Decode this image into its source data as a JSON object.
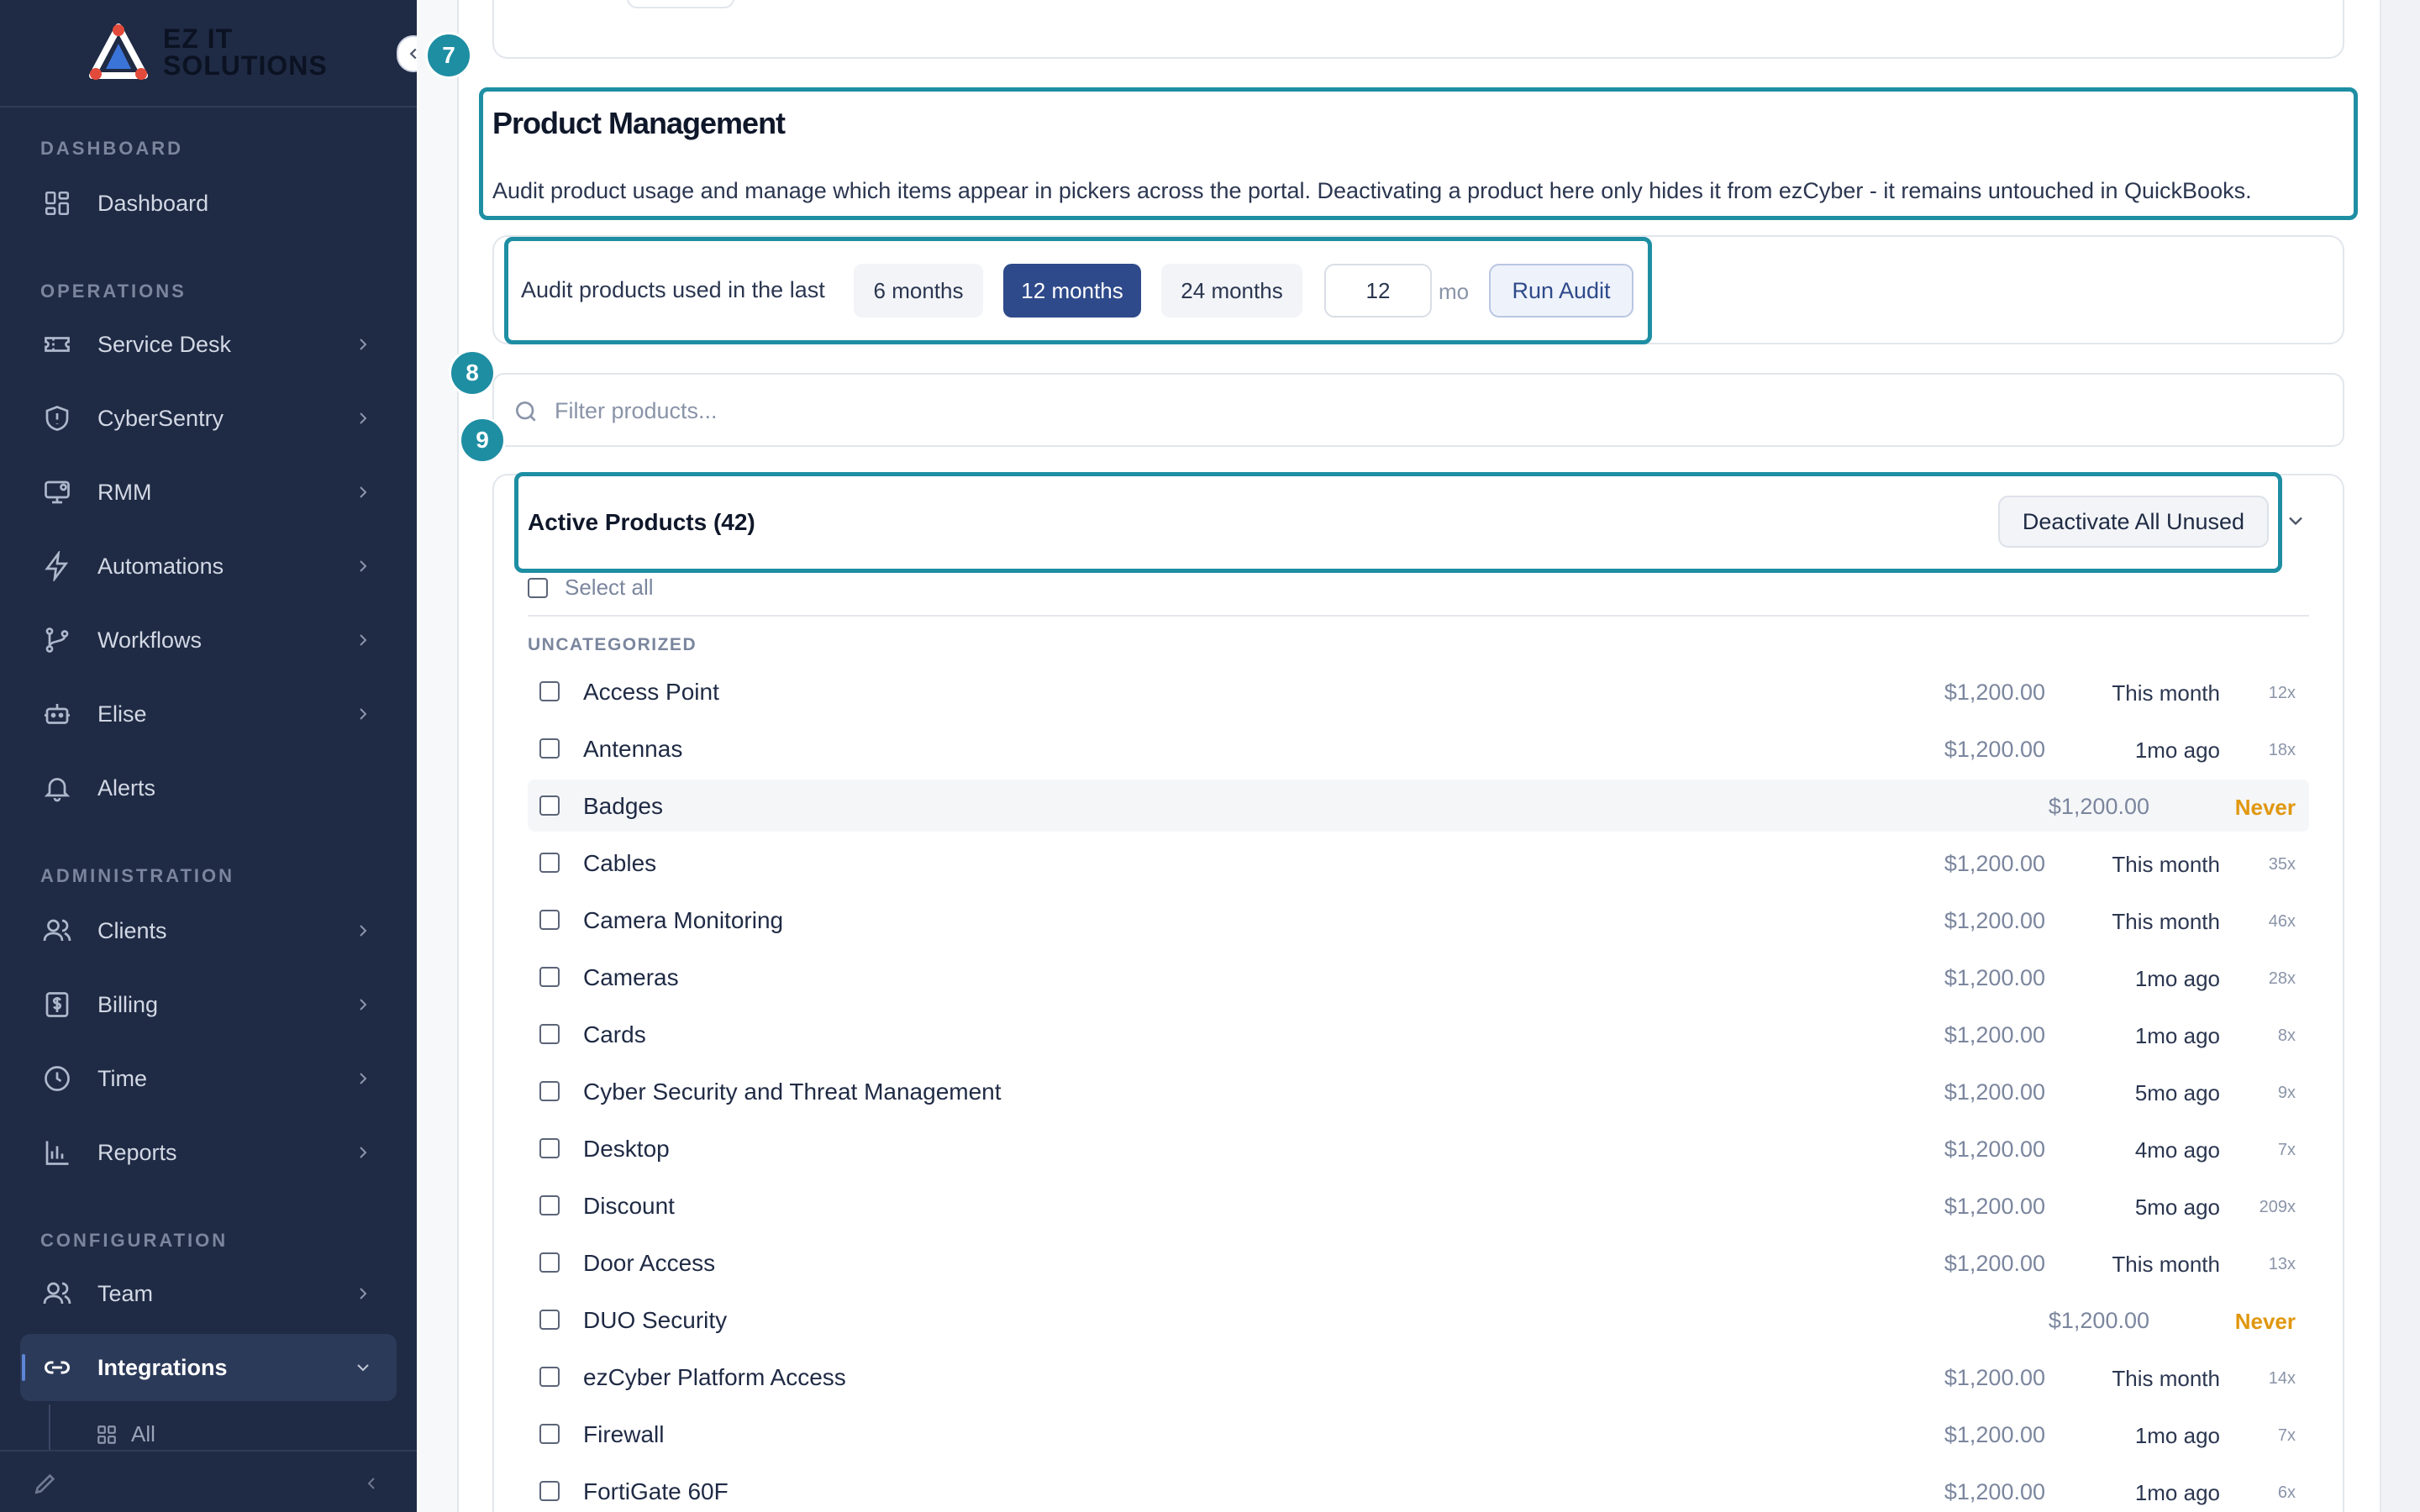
{
  "brand": {
    "name_line1": "EZ IT",
    "name_line2": "SOLUTIONS"
  },
  "sidebar": {
    "sections": {
      "dashboard": "DASHBOARD",
      "operations": "OPERATIONS",
      "administration": "ADMINISTRATION",
      "configuration": "CONFIGURATION"
    },
    "items": [
      {
        "label": "Dashboard",
        "icon": "grid-icon"
      },
      {
        "label": "Service Desk",
        "icon": "ticket-icon"
      },
      {
        "label": "CyberSentry",
        "icon": "shield-icon"
      },
      {
        "label": "RMM",
        "icon": "monitor-icon"
      },
      {
        "label": "Automations",
        "icon": "lightning-icon"
      },
      {
        "label": "Workflows",
        "icon": "branch-icon"
      },
      {
        "label": "Elise",
        "icon": "robot-icon"
      },
      {
        "label": "Alerts",
        "icon": "bell-icon"
      },
      {
        "label": "Clients",
        "icon": "users-icon"
      },
      {
        "label": "Billing",
        "icon": "dollar-doc-icon"
      },
      {
        "label": "Time",
        "icon": "clock-icon"
      },
      {
        "label": "Reports",
        "icon": "bar-chart-icon"
      },
      {
        "label": "Team",
        "icon": "users-icon"
      },
      {
        "label": "Integrations",
        "icon": "link-icon"
      }
    ],
    "sub_items": [
      {
        "label": "All",
        "icon": "grid-icon"
      }
    ]
  },
  "steps": {
    "seven": "7",
    "eight": "8",
    "nine": "9"
  },
  "product_management": {
    "title": "Product Management",
    "description": "Audit product usage and manage which items appear in pickers across the portal. Deactivating a product here only hides it from ezCyber - it remains untouched in QuickBooks."
  },
  "audit": {
    "label": "Audit products used in the last",
    "options": [
      "6 months",
      "12 months",
      "24 months"
    ],
    "selected": "12 months",
    "months_value": "12",
    "months_unit": "mo",
    "run_label": "Run Audit"
  },
  "filter": {
    "placeholder": "Filter products..."
  },
  "active_products": {
    "title": "Active Products (42)",
    "deactivate_label": "Deactivate All Unused",
    "select_all_label": "Select all",
    "group_label": "UNCATEGORIZED",
    "rows": [
      {
        "name": "Access Point",
        "price": "$1,200.00",
        "last_used": "This month",
        "count": "12x"
      },
      {
        "name": "Antennas",
        "price": "$1,200.00",
        "last_used": "1mo ago",
        "count": "18x"
      },
      {
        "name": "Badges",
        "price": "$1,200.00",
        "last_used": "Never",
        "count": ""
      },
      {
        "name": "Cables",
        "price": "$1,200.00",
        "last_used": "This month",
        "count": "35x"
      },
      {
        "name": "Camera Monitoring",
        "price": "$1,200.00",
        "last_used": "This month",
        "count": "46x"
      },
      {
        "name": "Cameras",
        "price": "$1,200.00",
        "last_used": "1mo ago",
        "count": "28x"
      },
      {
        "name": "Cards",
        "price": "$1,200.00",
        "last_used": "1mo ago",
        "count": "8x"
      },
      {
        "name": "Cyber Security and Threat Management",
        "price": "$1,200.00",
        "last_used": "5mo ago",
        "count": "9x"
      },
      {
        "name": "Desktop",
        "price": "$1,200.00",
        "last_used": "4mo ago",
        "count": "7x"
      },
      {
        "name": "Discount",
        "price": "$1,200.00",
        "last_used": "5mo ago",
        "count": "209x"
      },
      {
        "name": "Door Access",
        "price": "$1,200.00",
        "last_used": "This month",
        "count": "13x"
      },
      {
        "name": "DUO Security",
        "price": "$1,200.00",
        "last_used": "Never",
        "count": ""
      },
      {
        "name": "ezCyber Platform Access",
        "price": "$1,200.00",
        "last_used": "This month",
        "count": "14x"
      },
      {
        "name": "Firewall",
        "price": "$1,200.00",
        "last_used": "1mo ago",
        "count": "7x"
      },
      {
        "name": "FortiGate 60F",
        "price": "$1,200.00",
        "last_used": "1mo ago",
        "count": "6x"
      }
    ]
  },
  "colors": {
    "sidebar_bg": "#1f2a44",
    "accent": "#2e4a8a",
    "highlight": "#1e8ea3",
    "never": "#e0970f"
  }
}
